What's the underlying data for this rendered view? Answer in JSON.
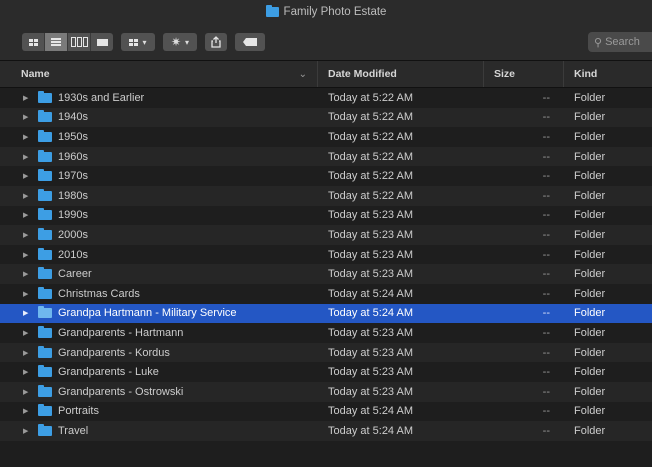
{
  "window": {
    "title": "Family Photo Estate"
  },
  "toolbar": {
    "view_buttons": [
      "icon-view",
      "list-view",
      "column-view",
      "gallery-view"
    ],
    "group_icon": "group-by-icon",
    "action_icon": "gear-icon",
    "share_icon": "share-icon",
    "tag_icon": "tag-icon"
  },
  "search": {
    "placeholder": "Search"
  },
  "columns": {
    "name": "Name",
    "date": "Date Modified",
    "size": "Size",
    "kind": "Kind",
    "sort_indicator": "⌄"
  },
  "files": [
    {
      "name": "1930s and Earlier",
      "date": "Today at 5:22 AM",
      "size": "--",
      "kind": "Folder"
    },
    {
      "name": "1940s",
      "date": "Today at 5:22 AM",
      "size": "--",
      "kind": "Folder"
    },
    {
      "name": "1950s",
      "date": "Today at 5:22 AM",
      "size": "--",
      "kind": "Folder"
    },
    {
      "name": "1960s",
      "date": "Today at 5:22 AM",
      "size": "--",
      "kind": "Folder"
    },
    {
      "name": "1970s",
      "date": "Today at 5:22 AM",
      "size": "--",
      "kind": "Folder"
    },
    {
      "name": "1980s",
      "date": "Today at 5:22 AM",
      "size": "--",
      "kind": "Folder"
    },
    {
      "name": "1990s",
      "date": "Today at 5:23 AM",
      "size": "--",
      "kind": "Folder"
    },
    {
      "name": "2000s",
      "date": "Today at 5:23 AM",
      "size": "--",
      "kind": "Folder"
    },
    {
      "name": "2010s",
      "date": "Today at 5:23 AM",
      "size": "--",
      "kind": "Folder"
    },
    {
      "name": "Career",
      "date": "Today at 5:23 AM",
      "size": "--",
      "kind": "Folder"
    },
    {
      "name": "Christmas Cards",
      "date": "Today at 5:24 AM",
      "size": "--",
      "kind": "Folder"
    },
    {
      "name": "Grandpa Hartmann - Military Service",
      "date": "Today at 5:24 AM",
      "size": "--",
      "kind": "Folder",
      "selected": true
    },
    {
      "name": "Grandparents - Hartmann",
      "date": "Today at 5:23 AM",
      "size": "--",
      "kind": "Folder"
    },
    {
      "name": "Grandparents - Kordus",
      "date": "Today at 5:23 AM",
      "size": "--",
      "kind": "Folder"
    },
    {
      "name": "Grandparents - Luke",
      "date": "Today at 5:23 AM",
      "size": "--",
      "kind": "Folder"
    },
    {
      "name": "Grandparents - Ostrowski",
      "date": "Today at 5:23 AM",
      "size": "--",
      "kind": "Folder"
    },
    {
      "name": "Portraits",
      "date": "Today at 5:24 AM",
      "size": "--",
      "kind": "Folder"
    },
    {
      "name": "Travel",
      "date": "Today at 5:24 AM",
      "size": "--",
      "kind": "Folder"
    }
  ],
  "colors": {
    "selection": "#2457c4",
    "folder": "#3d9ee4",
    "background": "#1e1e1e"
  }
}
